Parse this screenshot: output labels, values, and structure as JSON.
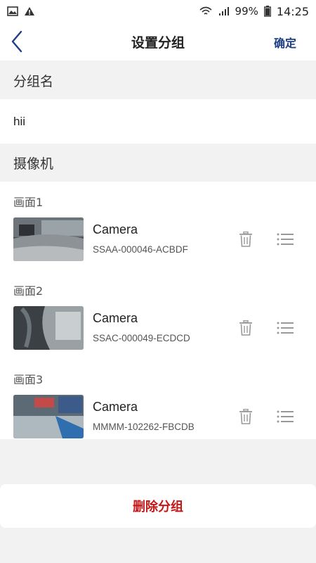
{
  "status_bar": {
    "battery": "99%",
    "time": "14:25",
    "icons": [
      "image-icon",
      "warning-icon",
      "wifi-icon",
      "signal-icon",
      "battery-icon"
    ]
  },
  "header": {
    "title": "设置分组",
    "confirm_label": "确定",
    "back_icon": "chevron-left-icon"
  },
  "group_name": {
    "label": "分组名",
    "value": "hii"
  },
  "cameras": {
    "label": "摄像机",
    "items": [
      {
        "label": "画面1",
        "name": "Camera",
        "serial": "SSAA-000046-ACBDF"
      },
      {
        "label": "画面2",
        "name": "Camera",
        "serial": "SSAC-000049-ECDCD"
      },
      {
        "label": "画面3",
        "name": "Camera",
        "serial": "MMMM-102262-FBCDB"
      }
    ]
  },
  "delete_label": "删除分组",
  "colors": {
    "accent": "#1e3f87",
    "danger": "#c41818",
    "background": "#f2f2f2"
  }
}
